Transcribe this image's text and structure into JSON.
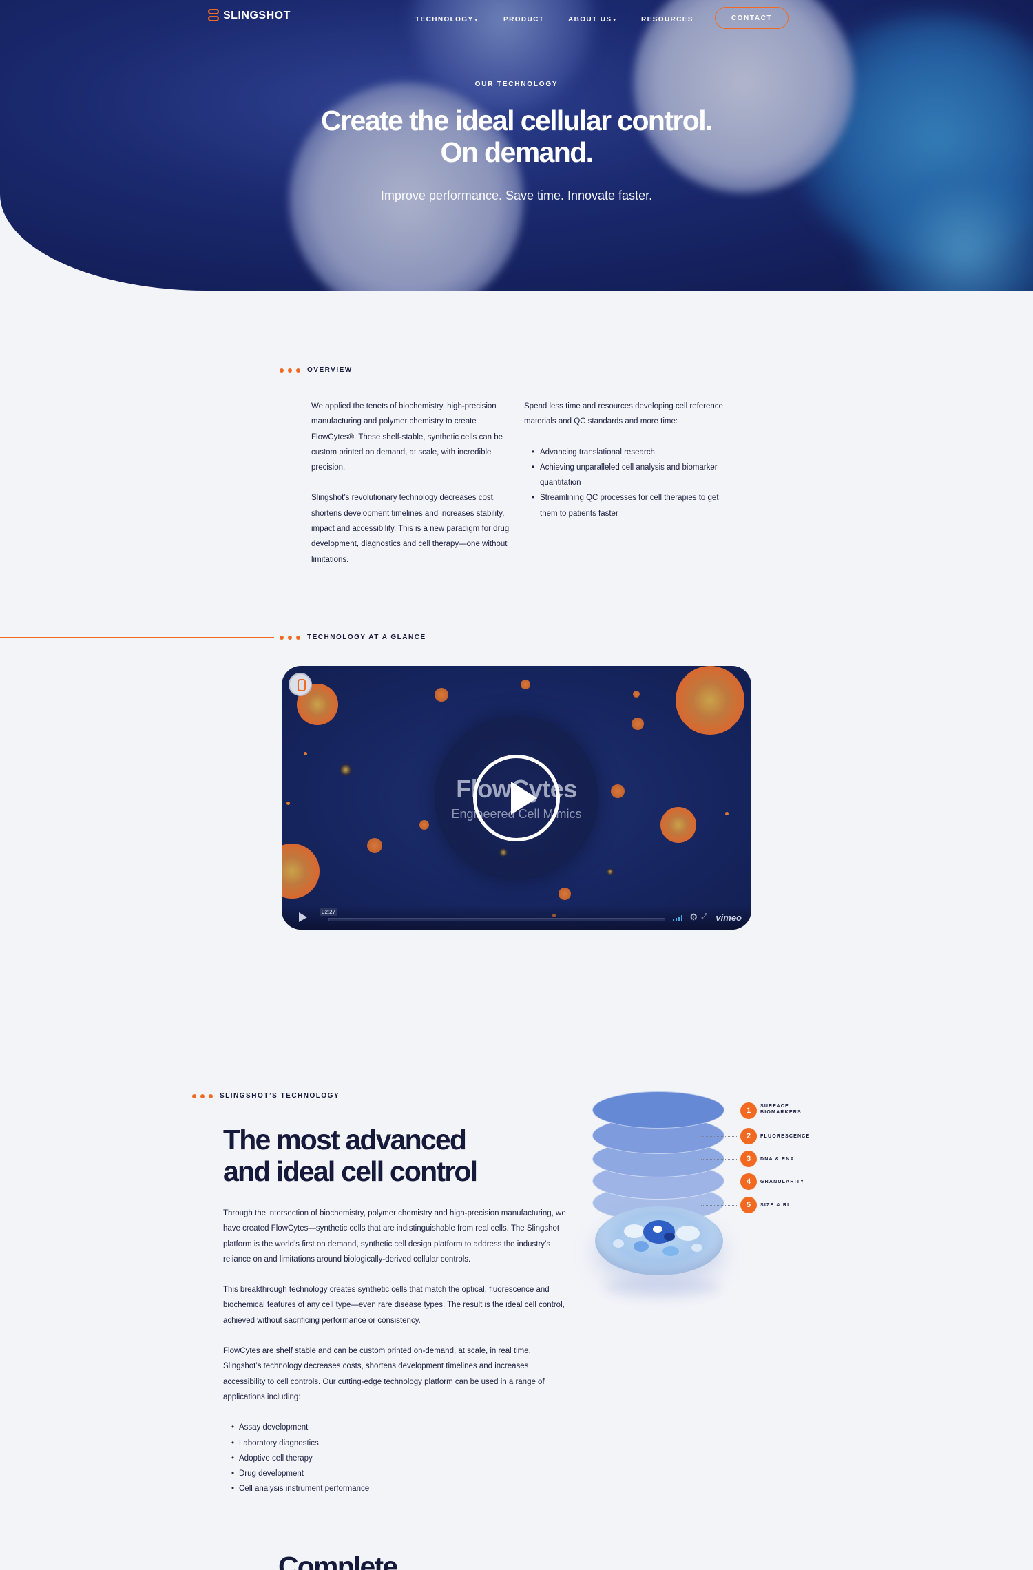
{
  "brand": {
    "logo_text": "SLINGSHOT"
  },
  "nav": {
    "items": [
      {
        "label": "TECHNOLOGY",
        "has_dropdown": true
      },
      {
        "label": "PRODUCT",
        "has_dropdown": false
      },
      {
        "label": "ABOUT US",
        "has_dropdown": true
      },
      {
        "label": "RESOURCES",
        "has_dropdown": false
      }
    ],
    "contact_label": "CONTACT"
  },
  "hero": {
    "eyebrow": "OUR TECHNOLOGY",
    "title_line1": "Create the ideal cellular control.",
    "title_line2": "On demand.",
    "subtitle": "Improve performance. Save time. Innovate faster."
  },
  "overview": {
    "label": "OVERVIEW",
    "left_p1": "We applied the tenets of biochemistry, high-precision manufacturing and polymer chemistry to create FlowCytes®. These shelf-stable, synthetic cells can be custom printed on demand, at scale, with incredible precision.",
    "left_p2": "Slingshot’s revolutionary technology decreases cost, shortens development timelines and increases stability, impact and accessibility. This is a new paradigm for drug development, diagnostics and cell therapy—one without limitations.",
    "right_intro": "Spend less time and resources developing cell reference materials and QC standards and more time:",
    "right_list": [
      "Advancing translational research",
      "Achieving unparalleled cell analysis and biomarker quantitation",
      "Streamlining QC processes for cell therapies to get them to patients faster"
    ]
  },
  "glance": {
    "label": "TECHNOLOGY AT A GLANCE",
    "video": {
      "title": "FlowCytes",
      "subtitle": "Engineered Cell Mimics",
      "time": "02:27",
      "provider": "vimeo"
    }
  },
  "technology": {
    "label": "SLINGSHOT’S TECHNOLOGY",
    "title_line1": "The most advanced",
    "title_line2": "and ideal cell control",
    "p1": "Through the intersection of biochemistry, polymer chemistry and high-precision manufacturing, we have created FlowCytes—synthetic cells that are indistinguishable from real cells. The Slingshot platform is the world’s first on demand, synthetic cell design platform to address the industry’s reliance on and limitations around biologically-derived cellular controls.",
    "p2": "This breakthrough technology creates synthetic cells that match the optical, fluorescence and biochemical features of any cell type—even rare disease types. The result is the ideal cell control, achieved without sacrificing performance or consistency.",
    "p3": "FlowCytes are shelf stable and can be custom printed on-demand, at scale, in real time. Slingshot’s technology decreases costs, shortens development timelines and increases accessibility to cell controls. Our cutting-edge technology platform can be used in a range of applications including:",
    "applications": [
      "Assay development",
      "Laboratory diagnostics",
      "Adoptive cell therapy",
      "Drug development",
      "Cell analysis instrument performance"
    ],
    "diagram_labels": [
      {
        "num": "1",
        "label": "SURFACE BIOMARKERS"
      },
      {
        "num": "2",
        "label": "FLUORESCENCE"
      },
      {
        "num": "3",
        "label": "DNA & RNA"
      },
      {
        "num": "4",
        "label": "GRANULARITY"
      },
      {
        "num": "5",
        "label": "SIZE & RI"
      }
    ]
  },
  "next_section": {
    "title_partial": "Complete"
  },
  "colors": {
    "accent": "#f26a21",
    "navy": "#151a3a",
    "background": "#f3f4f8"
  }
}
